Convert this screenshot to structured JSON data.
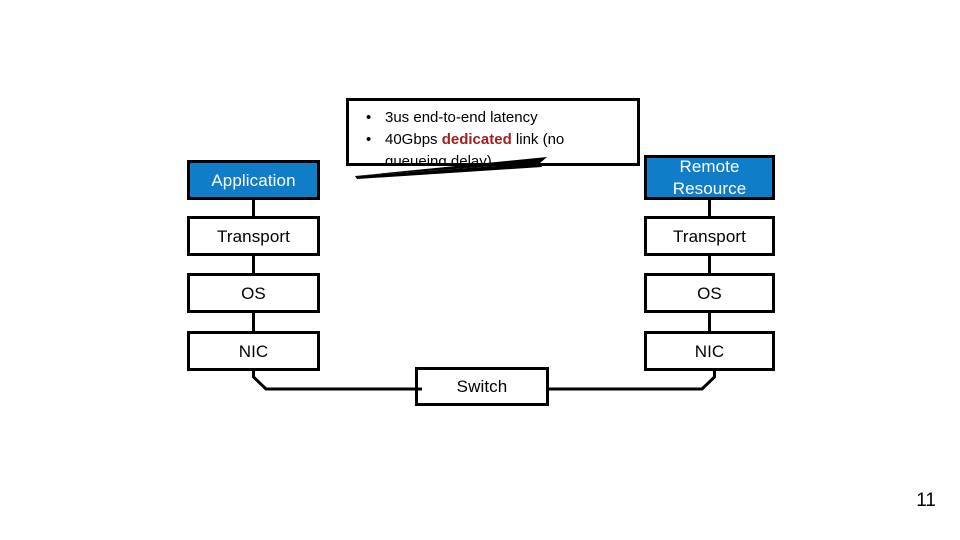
{
  "slide": {
    "page_number": "11",
    "colors": {
      "highlight_fill": "#0f7dc8",
      "highlight_text": "#ffffff",
      "box_stroke": "#000000",
      "box_fill": "#ffffff",
      "emphasis_red": "#9e2020",
      "background": "#ffffff"
    }
  },
  "callout": {
    "bullets": [
      {
        "marker": "•",
        "segments": [
          {
            "text": "3us end-to-end latency",
            "style": "normal"
          }
        ]
      },
      {
        "marker": "•",
        "segments": [
          {
            "text": "40Gbps ",
            "style": "normal"
          },
          {
            "text": "dedicated",
            "style": "red-bold"
          },
          {
            "text": " link (no queueing delay)",
            "style": "normal"
          }
        ]
      }
    ],
    "line1": "3us end-to-end latency",
    "line2_pre": "40Gbps ",
    "line2_kw": "dedicated",
    "line2_post": " link (no",
    "line3": "queueing delay)",
    "bullet_marker": "•"
  },
  "left_stack": {
    "name": "local-host-stack",
    "layers": [
      {
        "label": "Application",
        "highlight": true
      },
      {
        "label": "Transport",
        "highlight": false
      },
      {
        "label": "OS",
        "highlight": false
      },
      {
        "label": "NIC",
        "highlight": false
      }
    ]
  },
  "right_stack": {
    "name": "remote-host-stack",
    "layers": [
      {
        "label_line1": "Remote",
        "label_line2": "Resource",
        "highlight": true
      },
      {
        "label": "Transport",
        "highlight": false
      },
      {
        "label": "OS",
        "highlight": false
      },
      {
        "label": "NIC",
        "highlight": false
      }
    ]
  },
  "network": {
    "switch_label": "Switch"
  }
}
